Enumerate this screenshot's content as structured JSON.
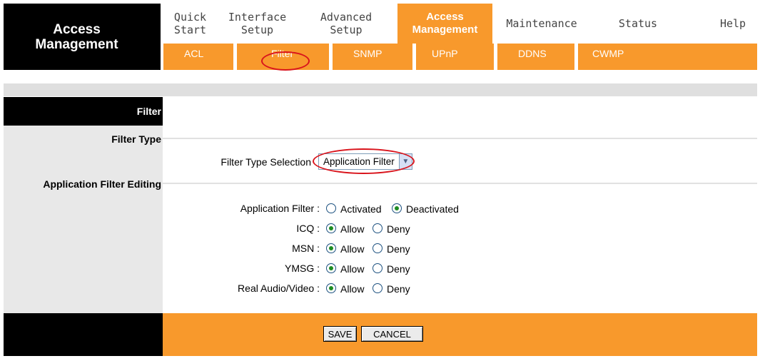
{
  "brand": {
    "line1": "Access",
    "line2": "Management"
  },
  "nav": {
    "quick_start": [
      "Quick",
      "Start"
    ],
    "interface_setup": [
      "Interface",
      "Setup"
    ],
    "advanced_setup": [
      "Advanced",
      "Setup"
    ],
    "access_management": [
      "Access",
      "Management"
    ],
    "maintenance": "Maintenance",
    "status": "Status",
    "help": "Help"
  },
  "subnav": {
    "acl": "ACL",
    "filter": "Filter",
    "snmp": "SNMP",
    "upnp": "UPnP",
    "ddns": "DDNS",
    "cwmp": "CWMP"
  },
  "sections": {
    "filter": "Filter",
    "filter_type": "Filter Type",
    "app_filter_editing": "Application Filter Editing"
  },
  "form": {
    "filter_type_selection_label": "Filter Type Selection",
    "filter_type_selected": "Application Filter",
    "application_filter_label": "Application Filter :",
    "activated": "Activated",
    "deactivated": "Deactivated",
    "rows": [
      {
        "label": "ICQ :",
        "allow": "Allow",
        "deny": "Deny"
      },
      {
        "label": "MSN :",
        "allow": "Allow",
        "deny": "Deny"
      },
      {
        "label": "YMSG :",
        "allow": "Allow",
        "deny": "Deny"
      },
      {
        "label": "Real Audio/Video :",
        "allow": "Allow",
        "deny": "Deny"
      }
    ]
  },
  "footer": {
    "save": "SAVE",
    "cancel": "CANCEL"
  },
  "colors": {
    "accent": "#f8992c",
    "highlight": "#d9141c",
    "dark": "#000000"
  }
}
